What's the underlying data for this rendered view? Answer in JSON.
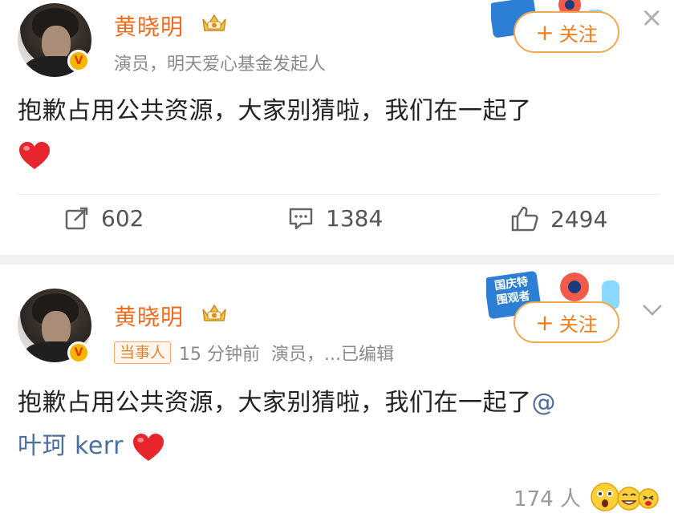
{
  "posts": [
    {
      "username": "黄晓明",
      "meta": "演员，明天爱心基金发起人",
      "follow_label": "关注",
      "follow_plus": "+",
      "verified": "V",
      "content": "抱歉占用公共资源，大家别猜啦，我们在一起了",
      "repost_count": "602",
      "comment_count": "1384",
      "like_count": "2494",
      "close_icon": "×"
    },
    {
      "username": "黄晓明",
      "tag": "当事人",
      "time": "15 分钟前",
      "meta": "演员，...已编辑",
      "follow_label": "关注",
      "follow_plus": "+",
      "verified": "V",
      "content": "抱歉占用公共资源，大家别猜啦，我们在一起了",
      "mention_prefix": "@",
      "mention_name": "叶珂 kerr",
      "reaction_count": "174 人",
      "chevron": "⌄"
    }
  ],
  "event_badge": {
    "line1": "国庆特",
    "line2": "围观者"
  },
  "colors": {
    "brand_orange": "#f26a1b",
    "follow_border": "#f4a74c",
    "mention_blue": "#4a6f9f",
    "heart_red": "#e8242c"
  },
  "icons": [
    "crown-icon",
    "verified-badge-icon",
    "repost-icon",
    "comment-icon",
    "like-icon",
    "heart-icon",
    "close-icon",
    "chevron-down-icon",
    "event-badge-icon",
    "reaction-emoji-icon"
  ]
}
